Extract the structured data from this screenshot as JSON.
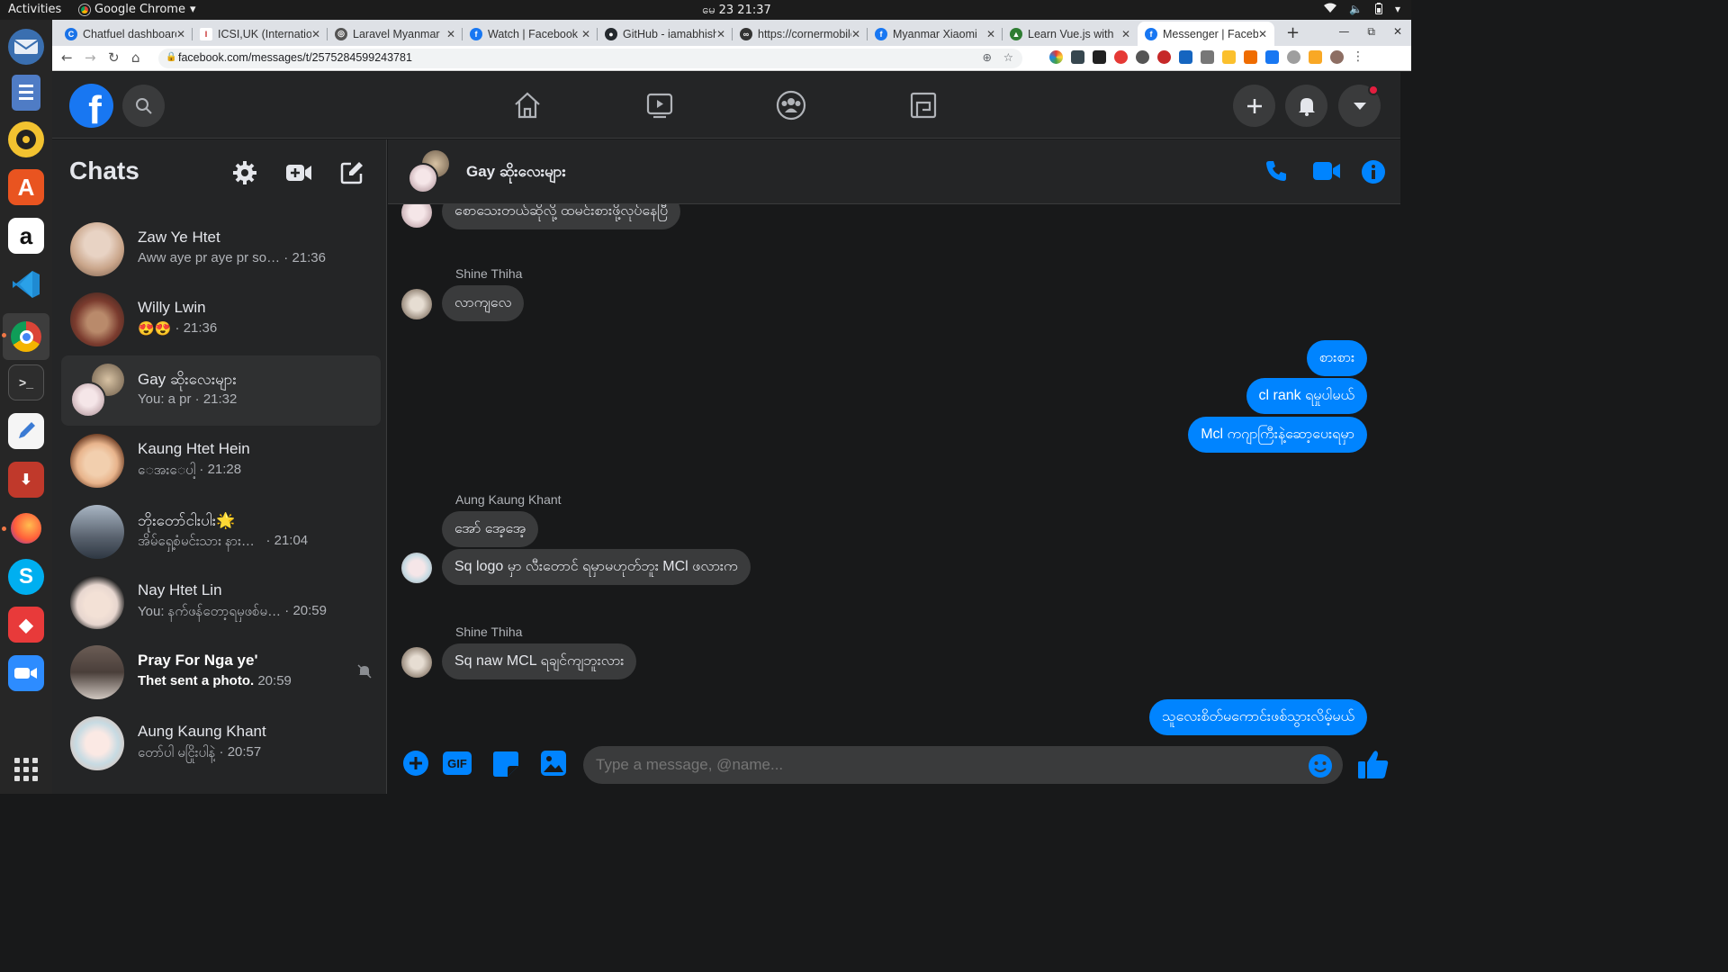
{
  "os": {
    "activities": "Activities",
    "app_name": "Google Chrome",
    "clock": "မေ 23  21:37"
  },
  "browser": {
    "tabs": [
      {
        "label": "Chatfuel dashboard",
        "color": "#1a73e8"
      },
      {
        "label": "ICSI,UK (International",
        "color": "#c62828"
      },
      {
        "label": "Laravel Myanmar",
        "color": "#555555"
      },
      {
        "label": "Watch | Facebook",
        "color": "#1877f2"
      },
      {
        "label": "GitHub - iamabhishek",
        "color": "#24292e"
      },
      {
        "label": "https://cornermobile",
        "color": "#333333"
      },
      {
        "label": "Myanmar Xiaomi",
        "color": "#1877f2"
      },
      {
        "label": "Learn Vue.js with",
        "color": "#2e7d32"
      },
      {
        "label": "Messenger | Facebook",
        "color": "#1877f2"
      }
    ],
    "url": "facebook.com/messages/t/2575284599243781"
  },
  "sidebar": {
    "title": "Chats",
    "chats": [
      {
        "name": "Zaw Ye Htet",
        "preview": "Aww aye pr aye pr so…",
        "time": "· 21:36",
        "avatar": "#c9a58a"
      },
      {
        "name": "Willy Lwin",
        "preview": "😍😍",
        "time": "· 21:36",
        "avatar": "#7a3b2e"
      },
      {
        "name": "Gay ဆိုးလေးများ",
        "preview": "You: a pr",
        "time": "· 21:32",
        "avatar": "#d8c2c6"
      },
      {
        "name": "Kaung Htet Hein",
        "preview": "ေအးေပါ့",
        "time": "· 21:28",
        "avatar": "#e8b48c"
      },
      {
        "name": "ဘိုးတော်ငါးပါး🌟",
        "preview": "အိမ်ရှေ့စံမင်းသား နား…",
        "time": "· 21:04",
        "avatar": "#59626e"
      },
      {
        "name": "Nay Htet Lin",
        "preview": "You: နက်ဖန်တော့ရမှဖစ်မ…",
        "time": "· 20:59",
        "avatar": "#e7d6cf"
      },
      {
        "name": "Pray For Nga ye'",
        "preview": "Thet sent a photo.",
        "time": "20:59",
        "avatar": "#4a3f3a"
      },
      {
        "name": "Aung Kaung Khant",
        "preview": "တော်ပါ မငြိုးပါနဲ့",
        "time": "· 20:57",
        "avatar": "#c7dbe3"
      }
    ]
  },
  "conversation": {
    "title": "Gay ဆိုးလေးများ",
    "messages": [
      {
        "text": "စောသေးတယ်ဆိုလို့ ထမင်းစားဖို့လုပ်နေပြီ"
      },
      {
        "sender": "Shine Thiha",
        "text": "လာကျလေ"
      },
      {
        "text": "စားစား"
      },
      {
        "text": "cl rank ရမှုပါမယ်"
      },
      {
        "text": "Mcl ကဂျာကြီးနဲ့ဆော့ပေးရမှာ"
      },
      {
        "sender": "Aung Kaung Khant",
        "text": "အော် အေ့အေ့"
      },
      {
        "text": "Sq logo မှာ လီးတောင် ရမှာမဟုတ်ဘူး MCl ဖလားက"
      },
      {
        "sender": "Shine Thiha",
        "text": "Sq naw MCL ရချင်ကျဘူးလား"
      },
      {
        "text": "သူလေးစိတ်မကောင်းဖစ်သွားလိမ့်မယ်"
      }
    ],
    "composer_placeholder": "Type a message, @name..."
  },
  "colors": {
    "accent": "#0084ff",
    "fb_blue": "#1877f2",
    "dark_bg": "#18191a",
    "panel": "#242526"
  }
}
